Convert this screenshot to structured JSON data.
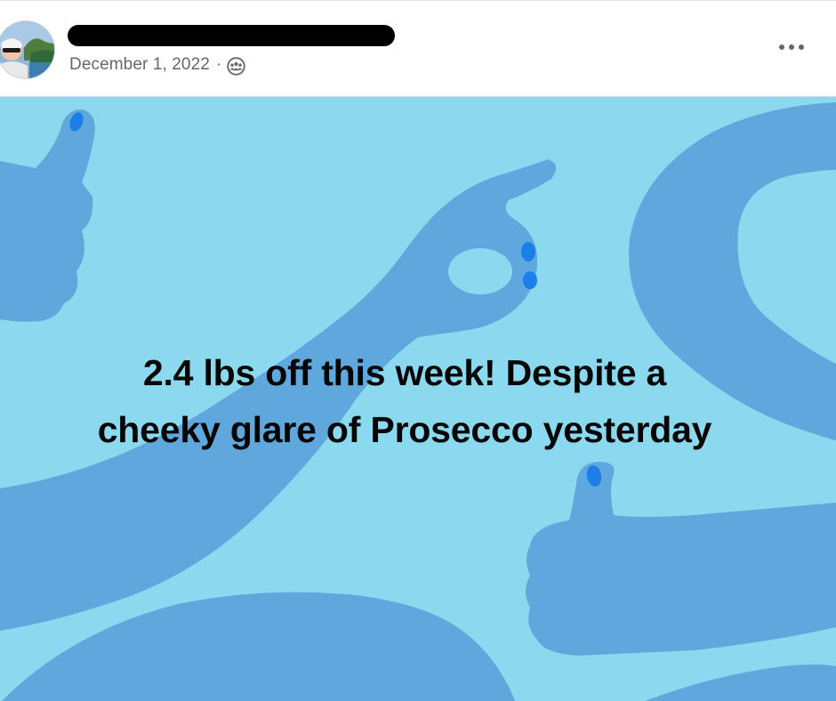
{
  "post": {
    "author_name": "",
    "date": "December 1, 2022",
    "separator": "·",
    "audience_icon": "friends-icon",
    "more_icon": "more-options-icon",
    "text_line1": "2.4 lbs off this week! Despite a",
    "text_line2": "cheeky glare of Prosecco yesterday"
  },
  "colors": {
    "background_light_blue": "#8bd9ef",
    "hand_blue": "#5fa8dd",
    "nail_blue": "#1a7fe8",
    "meta_gray": "#65676b",
    "text_black": "#050505"
  }
}
